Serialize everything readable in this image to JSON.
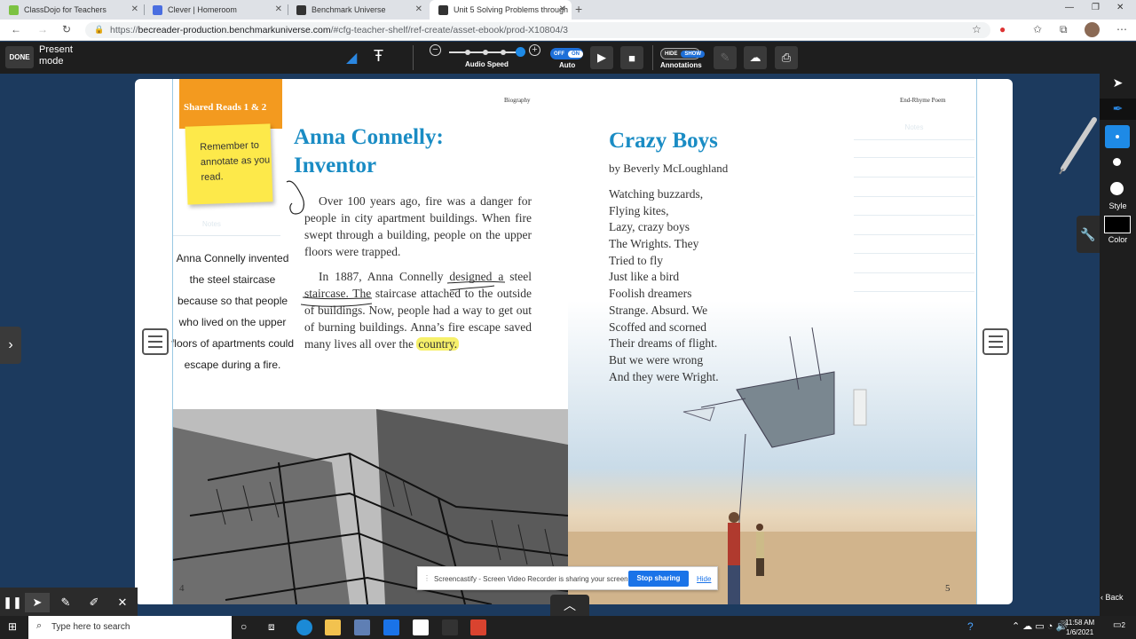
{
  "browser": {
    "tabs": [
      {
        "label": "ClassDojo for Teachers",
        "icon": "classdojo-icon",
        "color": "#7cc242"
      },
      {
        "label": "Clever | Homeroom",
        "icon": "clever-icon",
        "color": "#4a6ee0"
      },
      {
        "label": "Benchmark Universe",
        "icon": "benchmark-icon",
        "color": "#333333"
      },
      {
        "label": "Unit 5 Solving Problems through",
        "icon": "benchmark-icon",
        "color": "#333333"
      }
    ],
    "url_host": "becreader-production.benchmarkuniverse.com",
    "url_path": "/#cfg-teacher-shelf/ref-create/asset-ebook/prod-X10804/3",
    "url_scheme": "https://"
  },
  "toolbar": {
    "done_label": "DONE",
    "present_label": "Present mode",
    "audio_speed_label": "Audio Speed",
    "audio_speed_level": 1.0,
    "auto_off": "OFF",
    "auto_on": "ON",
    "auto_label": "Auto",
    "annot_hide": "HIDE",
    "annot_show": "SHOW",
    "annotations_label": "Annotations"
  },
  "palette": {
    "style_label": "Style",
    "color_label": "Color"
  },
  "page_left": {
    "tab_label": "Shared Reads 1 & 2",
    "sticky_text": "Remember to annotate as you read.",
    "notes_label": "Notes",
    "genre_label": "Biography",
    "note_text": "Anna Connelly invented the steel staircase because so that people who lived on the upper floors of apartments could escape during a fire.",
    "title": "Anna Connelly: Inventor",
    "para1": "Over 100 years ago, fire was a danger for people in city apartment buildings. When fire swept through a building, people on the upper floors were trapped.",
    "para2_a": "In 1887, Anna Connelly designed a steel staircase. The staircase attached to the outside of buildings. Now, people had a way to get out of burning buildings. Anna’s fire escape saved many lives all over the ",
    "para2_hl": "country.",
    "page_number": "4"
  },
  "page_right": {
    "genre_label": "End-Rhyme Poem",
    "notes_label": "Notes",
    "title": "Crazy Boys",
    "byline": "by Beverly McLoughland",
    "poem_lines": [
      "Watching buzzards,",
      "Flying kites,",
      "Lazy, crazy boys",
      "The Wrights. They",
      "Tried to fly",
      "Just like a bird",
      "Foolish dreamers",
      "Strange. Absurd. We",
      "Scoffed and scorned",
      "Their dreams of flight.",
      "But we were wrong",
      "And they were Wright."
    ],
    "page_number": "5"
  },
  "banner": {
    "text": "Screencastify - Screen Video Recorder is sharing your screen.",
    "stop_label": "Stop sharing",
    "hide_label": "Hide"
  },
  "nav": {
    "back_label": "Back"
  },
  "taskbar": {
    "search_placeholder": "Type here to search",
    "time": "11:58 AM",
    "date": "1/6/2021",
    "notif_count": "2"
  }
}
